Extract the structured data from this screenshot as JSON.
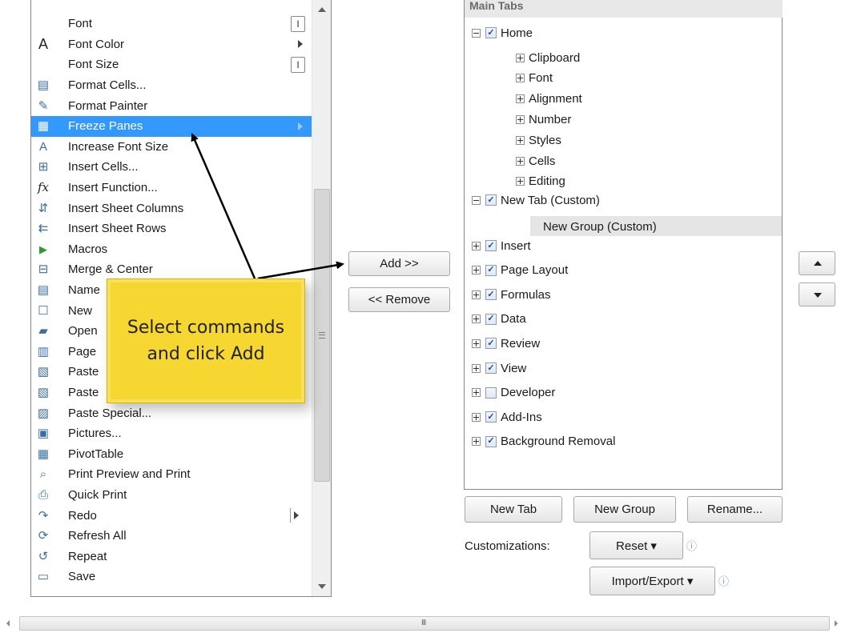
{
  "commands": [
    {
      "label": "Font",
      "icon": "font-name-icon",
      "glyph": "",
      "widget": "editbox"
    },
    {
      "label": "Font Color",
      "icon": "font-color-icon",
      "glyph": "A",
      "widget": "submenu"
    },
    {
      "label": "Font Size",
      "icon": "font-size-icon",
      "glyph": "",
      "widget": "editbox"
    },
    {
      "label": "Format Cells...",
      "icon": "format-cells-icon",
      "glyph": "▤",
      "widget": ""
    },
    {
      "label": "Format Painter",
      "icon": "paintbrush-icon",
      "glyph": "✎",
      "widget": ""
    },
    {
      "label": "Freeze Panes",
      "icon": "freeze-panes-icon",
      "glyph": "▦",
      "widget": "submenu",
      "selected": true
    },
    {
      "label": "Increase Font Size",
      "icon": "increase-font-size-icon",
      "glyph": "A",
      "widget": ""
    },
    {
      "label": "Insert Cells...",
      "icon": "insert-cells-icon",
      "glyph": "⊞",
      "widget": ""
    },
    {
      "label": "Insert Function...",
      "icon": "insert-function-icon",
      "glyph": "fx",
      "widget": ""
    },
    {
      "label": "Insert Sheet Columns",
      "icon": "insert-columns-icon",
      "glyph": "⇵",
      "widget": ""
    },
    {
      "label": "Insert Sheet Rows",
      "icon": "insert-rows-icon",
      "glyph": "⇇",
      "widget": ""
    },
    {
      "label": "Macros",
      "icon": "macros-icon",
      "glyph": "▶",
      "widget": ""
    },
    {
      "label": "Merge & Center",
      "icon": "merge-center-icon",
      "glyph": "⊟",
      "widget": ""
    },
    {
      "label": "Name",
      "icon": "name-manager-icon",
      "glyph": "▤",
      "widget": ""
    },
    {
      "label": "New",
      "icon": "new-document-icon",
      "glyph": "☐",
      "widget": ""
    },
    {
      "label": "Open",
      "icon": "open-folder-icon",
      "glyph": "▰",
      "widget": ""
    },
    {
      "label": "Page",
      "icon": "page-setup-icon",
      "glyph": "▥",
      "widget": ""
    },
    {
      "label": "Paste",
      "icon": "paste-icon",
      "glyph": "▧",
      "widget": ""
    },
    {
      "label": "Paste",
      "icon": "paste-icon",
      "glyph": "▧",
      "widget": ""
    },
    {
      "label": "Paste Special...",
      "icon": "paste-special-icon",
      "glyph": "▨",
      "widget": ""
    },
    {
      "label": "Pictures...",
      "icon": "pictures-icon",
      "glyph": "▣",
      "widget": ""
    },
    {
      "label": "PivotTable",
      "icon": "pivottable-icon",
      "glyph": "▦",
      "widget": ""
    },
    {
      "label": "Print Preview and Print",
      "icon": "print-preview-icon",
      "glyph": "⌕",
      "widget": ""
    },
    {
      "label": "Quick Print",
      "icon": "quick-print-icon",
      "glyph": "⎙",
      "widget": ""
    },
    {
      "label": "Redo",
      "icon": "redo-icon",
      "glyph": "↷",
      "widget": "splitarrow"
    },
    {
      "label": "Refresh All",
      "icon": "refresh-all-icon",
      "glyph": "⟳",
      "widget": ""
    },
    {
      "label": "Repeat",
      "icon": "repeat-icon",
      "glyph": "↺",
      "widget": ""
    },
    {
      "label": "Save",
      "icon": "save-icon",
      "glyph": "▭",
      "widget": ""
    }
  ],
  "buttons": {
    "add": "Add >>",
    "remove": "<< Remove",
    "new_tab": "New Tab",
    "new_group": "New Group",
    "rename": "Rename...",
    "reset": "Reset ▾",
    "import_export": "Import/Export ▾"
  },
  "customizations_label": "Customizations:",
  "info_glyph": "ⓘ",
  "tree": {
    "header": "Main Tabs",
    "home": {
      "label": "Home",
      "checked": true,
      "expanded": true
    },
    "home_groups": [
      "Clipboard",
      "Font",
      "Alignment",
      "Number",
      "Styles",
      "Cells",
      "Editing"
    ],
    "new_tab": {
      "label": "New Tab (Custom)",
      "checked": true
    },
    "new_group": "New Group (Custom)",
    "tabs": [
      {
        "label": "Insert",
        "checked": true
      },
      {
        "label": "Page Layout",
        "checked": true
      },
      {
        "label": "Formulas",
        "checked": true
      },
      {
        "label": "Data",
        "checked": true
      },
      {
        "label": "Review",
        "checked": true
      },
      {
        "label": "View",
        "checked": true
      },
      {
        "label": "Developer",
        "checked": false
      },
      {
        "label": "Add-Ins",
        "checked": true
      },
      {
        "label": "Background Removal",
        "checked": true
      }
    ]
  },
  "callout": "Select commands and click Add",
  "hscroll_grip": "III",
  "colors": {
    "selection": "#3399ff",
    "callout": "#f6d631",
    "arrow": "#000000"
  }
}
